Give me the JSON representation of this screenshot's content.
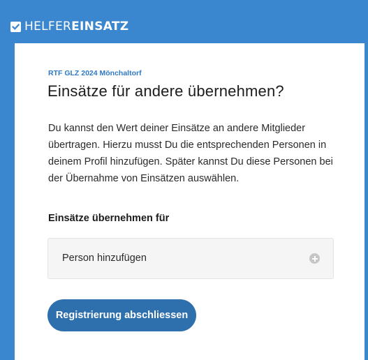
{
  "header": {
    "logo_light": "HELFER",
    "logo_bold": "EINSATZ",
    "background_color": "#3a86cf"
  },
  "card": {
    "event_name": "RTF GLZ 2024 Mönchaltorf",
    "title": "Einsätze für andere übernehmen?",
    "intro": "Du kannst den Wert deiner Einsätze an andere Mitglieder übertragen. Hierzu musst Du die entsprechenden Personen in deinem Profil hinzufügen. Später kannst Du diese Personen bei der Übernahme von Einsätzen auswählen.",
    "field_label": "Einsätze übernehmen für",
    "add_person": {
      "label": "Person hinzufügen",
      "icon": "plus-circle-icon"
    },
    "submit_label": "Registrierung abschliessen",
    "accent_color": "#2e79c2",
    "button_color": "#2e6fae"
  }
}
